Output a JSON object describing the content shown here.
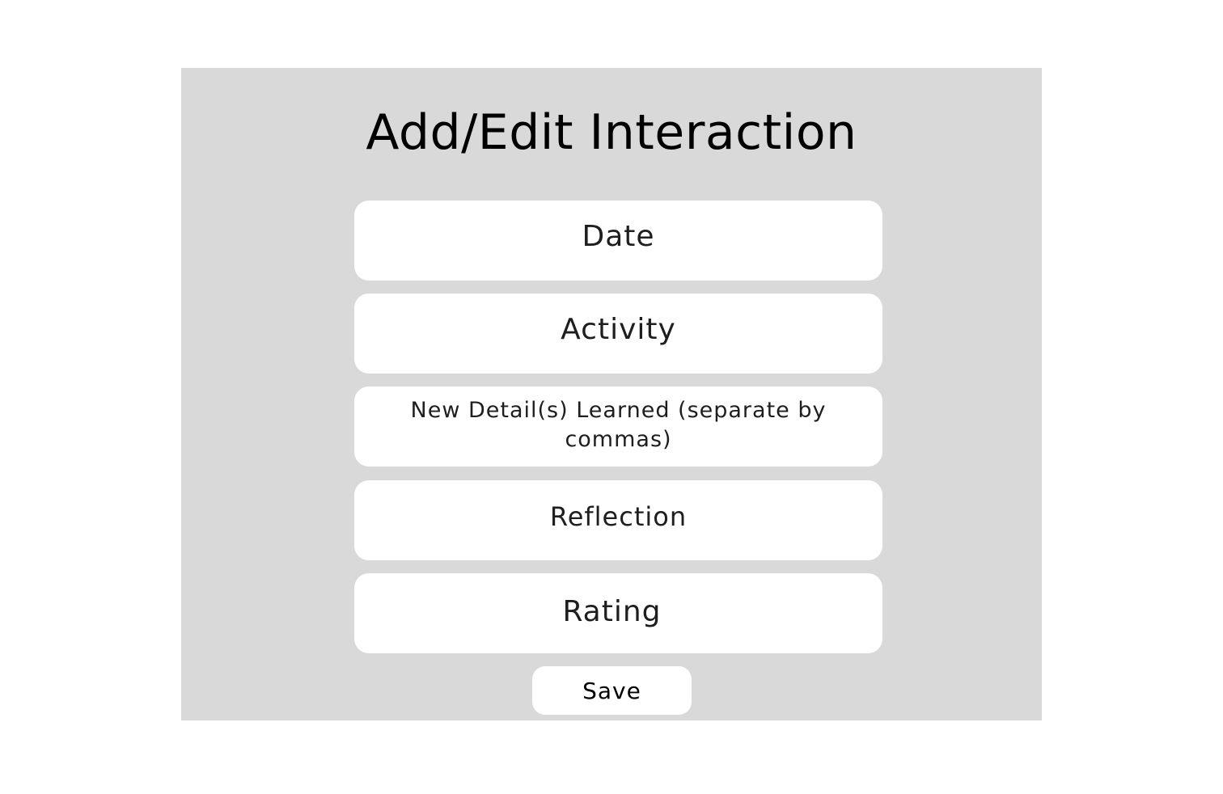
{
  "form": {
    "title": "Add/Edit Interaction",
    "fields": [
      {
        "label": "Date"
      },
      {
        "label": "Activity"
      },
      {
        "label": "New Detail(s) Learned (separate by commas)"
      },
      {
        "label": "Reflection"
      },
      {
        "label": "Rating"
      }
    ],
    "save_label": "Save"
  },
  "colors": {
    "page_background": "#ffffff",
    "panel_background": "#d9d9d9",
    "field_background": "#ffffff",
    "text": "#1e1e1e"
  }
}
